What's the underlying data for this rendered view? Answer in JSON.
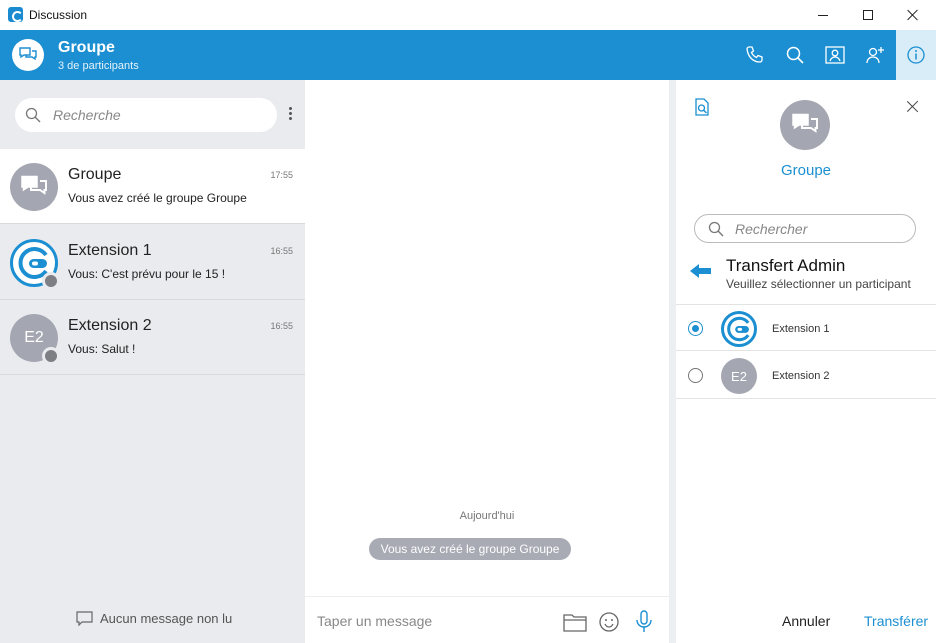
{
  "window": {
    "title": "Discussion"
  },
  "header": {
    "title": "Groupe",
    "subtitle": "3 de participants"
  },
  "left": {
    "search_placeholder": "Recherche",
    "conversations": [
      {
        "name": "Groupe",
        "time": "17:55",
        "message": "Vous avez créé le groupe Groupe",
        "avatar": "group-icon"
      },
      {
        "name": "Extension 1",
        "time": "16:55",
        "message": "Vous: C'est prévu pour le 15 !",
        "avatar": "extension-logo"
      },
      {
        "name": "Extension 2",
        "time": "16:55",
        "message": "Vous: Salut !",
        "avatar": "E2"
      }
    ],
    "unread_label": "Aucun message non lu"
  },
  "center": {
    "day_label": "Aujourd'hui",
    "system_message": "Vous avez créé le groupe Groupe",
    "compose_placeholder": "Taper un message"
  },
  "right": {
    "group_name": "Groupe",
    "search_placeholder": "Rechercher",
    "transfer_title": "Transfert Admin",
    "transfer_subtitle": "Veuillez sélectionner un participant",
    "participants": [
      {
        "name": "Extension 1",
        "avatar": "extension-logo",
        "selected": true
      },
      {
        "name": "Extension 2",
        "avatar": "E2",
        "selected": false
      }
    ],
    "cancel_label": "Annuler",
    "transfer_label": "Transférer"
  },
  "colors": {
    "accent": "#1b8fd1",
    "avatar_gray": "#a4a6b1",
    "sidebar_bg": "#e9ebef"
  }
}
